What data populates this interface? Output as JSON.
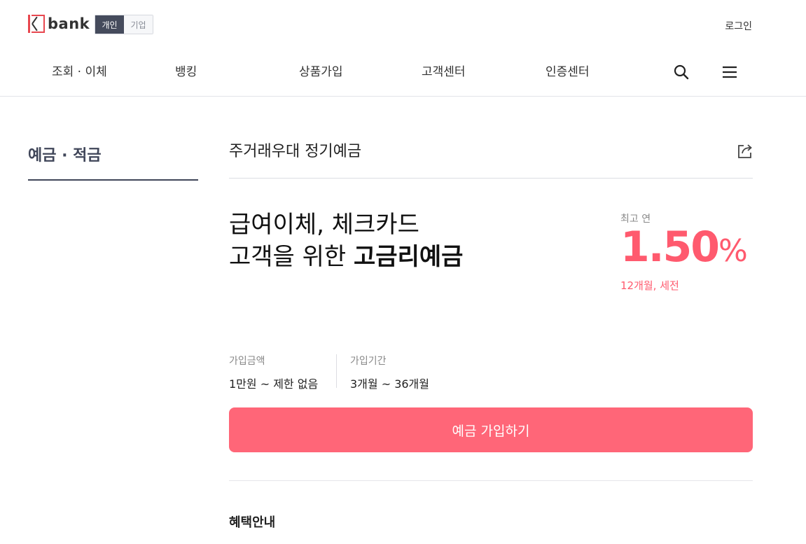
{
  "header": {
    "logo_text": "bank",
    "type_toggle": {
      "personal": "개인",
      "business": "기업"
    },
    "login": "로그인"
  },
  "gnb": {
    "items": [
      "조회 · 이체",
      "뱅킹",
      "상품가입",
      "고객센터",
      "인증센터"
    ],
    "search_icon": "search-icon",
    "menu_icon": "hamburger-menu-icon"
  },
  "lnb": {
    "title": "예금 · 적금"
  },
  "product": {
    "title": "주거래우대 정기예금",
    "share_icon": "share-icon",
    "headline_line1": "급여이체, 체크카드",
    "headline_line2_prefix": "고객을 위한 ",
    "headline_line2_bold": "고금리예금",
    "rate_label": "최고 연",
    "rate_value": "1.50",
    "rate_unit": "%",
    "rate_note": "12개월, 세전",
    "amount_label": "가입금액",
    "amount_value": "1만원 ~ 제한 없음",
    "period_label": "가입기간",
    "period_value": "3개월 ~ 36개월",
    "join_button": "예금 가입하기",
    "benefit_title": "혜택안내"
  },
  "colors": {
    "accent": "#ff5a6e",
    "button": "#ff6678",
    "dark": "#404659"
  }
}
